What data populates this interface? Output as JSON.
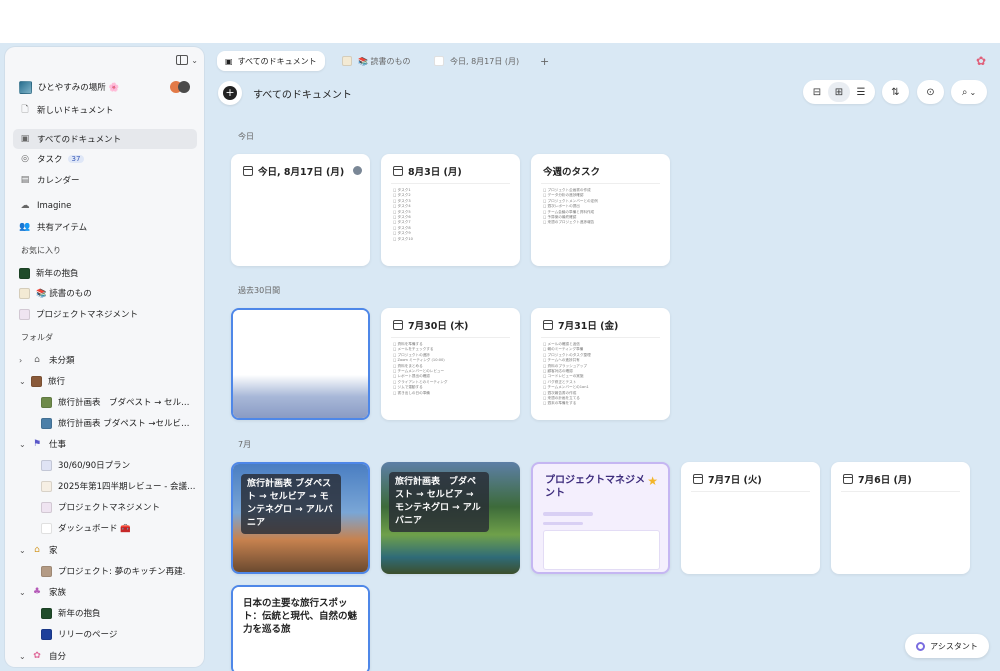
{
  "sidebar": {
    "workspace": "ひとやすみの場所 🌸",
    "new_doc": "新しいドキュメント",
    "nav": [
      {
        "label": "すべてのドキュメント"
      },
      {
        "label": "タスク",
        "badge": "37"
      },
      {
        "label": "カレンダー"
      },
      {
        "label": "Imagine"
      },
      {
        "label": "共有アイテム"
      }
    ],
    "favorites_title": "お気に入り",
    "favorites": [
      "新年の抱負",
      "📚 読書のもの",
      "プロジェクトマネジメント"
    ],
    "folders_title": "フォルダ",
    "folders": [
      {
        "label": "未分類"
      },
      {
        "label": "旅行"
      },
      {
        "label": "旅行計画表　ブダペスト → セルビア…"
      },
      {
        "label": "旅行計画表 ブダペスト →セルビア…"
      },
      {
        "label": "仕事"
      },
      {
        "label": "30/60/90日プラン"
      },
      {
        "label": "2025年第1四半期レビュー - 会議…"
      },
      {
        "label": "プロジェクトマネジメント"
      },
      {
        "label": "ダッシュボード 🧰"
      },
      {
        "label": "家"
      },
      {
        "label": "プロジェクト: 夢のキッチン再建."
      },
      {
        "label": "家族"
      },
      {
        "label": "新年の抱負"
      },
      {
        "label": "リリーのページ"
      },
      {
        "label": "自分"
      }
    ]
  },
  "tabs": [
    {
      "label": "すべてのドキュメント"
    },
    {
      "label": "📚 読書のもの"
    },
    {
      "label": "今日, 8月17日 (月)"
    }
  ],
  "tab_add": "+",
  "header": {
    "title": "すべてのドキュメント"
  },
  "groups": {
    "today": "今日",
    "past30": "過去30日間",
    "july": "7月"
  },
  "cards": {
    "c1": {
      "title": "今日, 8月17日 (月)"
    },
    "c2": {
      "title": "8月3日 (月)",
      "lines": [
        "□ タスク1",
        "□ タスク2",
        "□ タスク3",
        "□ タスク4",
        "□ タスク5",
        "□ タスク6",
        "□ タスク7",
        "□ タスク8",
        "□ タスク9",
        "□ タスク10"
      ]
    },
    "c3": {
      "title": "今週のタスク",
      "lines": [
        "□ プロジェクト企画書の作成",
        "□ データ分析の進捗確認",
        "□ プロジェクトメンバーとの定例",
        "□ 週次レポートの提出",
        "□ チーム会議の準備と資料作成",
        "□ 予算案の最終確認",
        "□ 来週のプロジェクト進捗報告"
      ]
    },
    "c5": {
      "title": "7月30日 (木)",
      "lines": [
        "□ 資料を準備する",
        "□ メールをチェックする",
        "□ プロジェクトの進捗",
        "□ Zoom ミーティング (10:00)",
        "□ 資料をまとめる",
        "□ チームメンバーとのレビュー",
        "□ レポート提出の確認",
        "□ クライアントとのミーティング",
        "□ ジムで運動する",
        "□ 書き出しの日の準備"
      ]
    },
    "c6": {
      "title": "7月31日 (金)",
      "lines": [
        "□ メールの確認と返信",
        "□ 朝のミーティング準備",
        "□ プロジェクトのタスク整理",
        "□ チームへの進捗共有",
        "□ 資料のブラッシュアップ",
        "□ 顧客対応の確認",
        "□ コードレビューの実施",
        "□ バグ修正とテスト",
        "□ チームメンバーとの1on1",
        "□ 週次報告書の作成",
        "□ 来週の計画を立てる",
        "□ 週末の準備をする"
      ]
    },
    "c7": {
      "title": "旅行計画表 ブダペスト → セルビア → モンテネグロ → アルバニア"
    },
    "c8": {
      "title": "旅行計画表　ブダペスト → セルビア → モンテネグロ → アルバニア"
    },
    "c9": {
      "title": "プロジェクトマネジメント"
    },
    "c10": {
      "title": "7月7日 (火)"
    },
    "c11": {
      "title": "7月6日 (月)"
    },
    "c12": {
      "title": "日本の主要な旅行スポット：伝統と現代、自然の魅力を巡る旅"
    }
  },
  "assistant_label": "アシスタント",
  "colors": {
    "accent": "#4e87e8",
    "background": "#d9e8f4",
    "star": "#f3b52a"
  }
}
